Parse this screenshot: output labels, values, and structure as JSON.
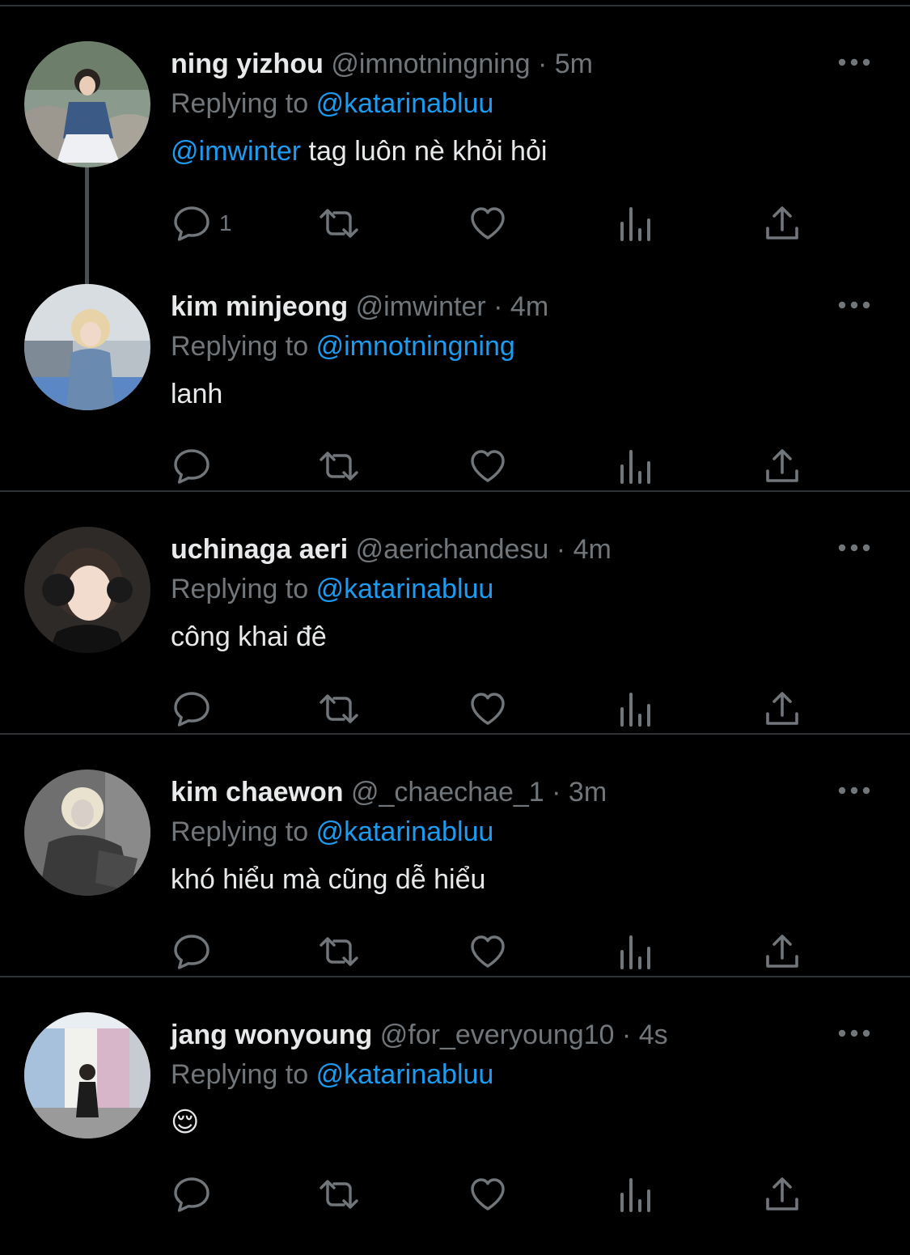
{
  "colors": {
    "background": "#000000",
    "primary_text": "#e7e9ea",
    "secondary_text": "#71767b",
    "accent": "#1d9bf0",
    "divider": "#2f3336"
  },
  "icons": {
    "more": "more-dots-icon",
    "reply": "reply-bubble-icon",
    "retweet": "retweet-arrows-icon",
    "like": "heart-icon",
    "views": "bar-chart-icon",
    "share": "share-upload-icon"
  },
  "tweets": [
    {
      "name": "ning yizhou",
      "handle": "@imnotningning",
      "separator": "·",
      "time": "5m",
      "replying_prefix": "Replying to",
      "replying_to": "@katarinabluu",
      "text_mention": "@imwinter",
      "text": " tag luôn nè khỏi hỏi",
      "reply_count": "1"
    },
    {
      "name": "kim minjeong",
      "handle": "@imwinter",
      "separator": "·",
      "time": "4m",
      "replying_prefix": "Replying to",
      "replying_to": "@imnotningning",
      "text": "lanh"
    },
    {
      "name": "uchinaga aeri",
      "handle": "@aerichandesu",
      "separator": "·",
      "time": "4m",
      "replying_prefix": "Replying to",
      "replying_to": "@katarinabluu",
      "text": "công khai đê"
    },
    {
      "name": "kim chaewon",
      "handle": "@_chaechae_1",
      "separator": "·",
      "time": "3m",
      "replying_prefix": "Replying to",
      "replying_to": "@katarinabluu",
      "text": "khó hiểu mà cũng dễ hiểu"
    },
    {
      "name": "jang wonyoung",
      "handle": "@for_everyoung10",
      "separator": "·",
      "time": "4s",
      "replying_prefix": "Replying to",
      "replying_to": "@katarinabluu",
      "text": "😌"
    }
  ]
}
